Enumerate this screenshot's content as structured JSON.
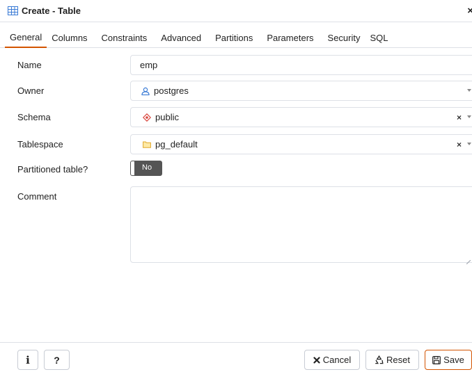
{
  "window": {
    "title": "Create - Table",
    "close_glyph": "×"
  },
  "tabs": [
    {
      "label": "General",
      "active": true
    },
    {
      "label": "Columns"
    },
    {
      "label": "Constraints"
    },
    {
      "label": "Advanced"
    },
    {
      "label": "Partitions"
    },
    {
      "label": "Parameters"
    },
    {
      "label": "Security"
    },
    {
      "label": "SQL"
    }
  ],
  "form": {
    "name": {
      "label": "Name",
      "value": "emp"
    },
    "owner": {
      "label": "Owner",
      "value": "postgres",
      "icon": "user-icon"
    },
    "schema": {
      "label": "Schema",
      "value": "public",
      "icon": "schema-icon",
      "clear": "×"
    },
    "tablespace": {
      "label": "Tablespace",
      "value": "pg_default",
      "icon": "folder-icon",
      "clear": "×"
    },
    "partitioned": {
      "label": "Partitioned table?",
      "value": "No"
    },
    "comment": {
      "label": "Comment",
      "value": ""
    }
  },
  "footer": {
    "info_label": "i",
    "help_label": "?",
    "cancel_label": "Cancel",
    "reset_label": "Reset",
    "save_label": "Save"
  },
  "colors": {
    "accent": "#d35400",
    "border": "#dde0e6",
    "toggle_bg": "#555555",
    "icon_blue": "#3a7bd5",
    "schema_red": "#d9453d",
    "folder_yellow": "#f5c242"
  }
}
